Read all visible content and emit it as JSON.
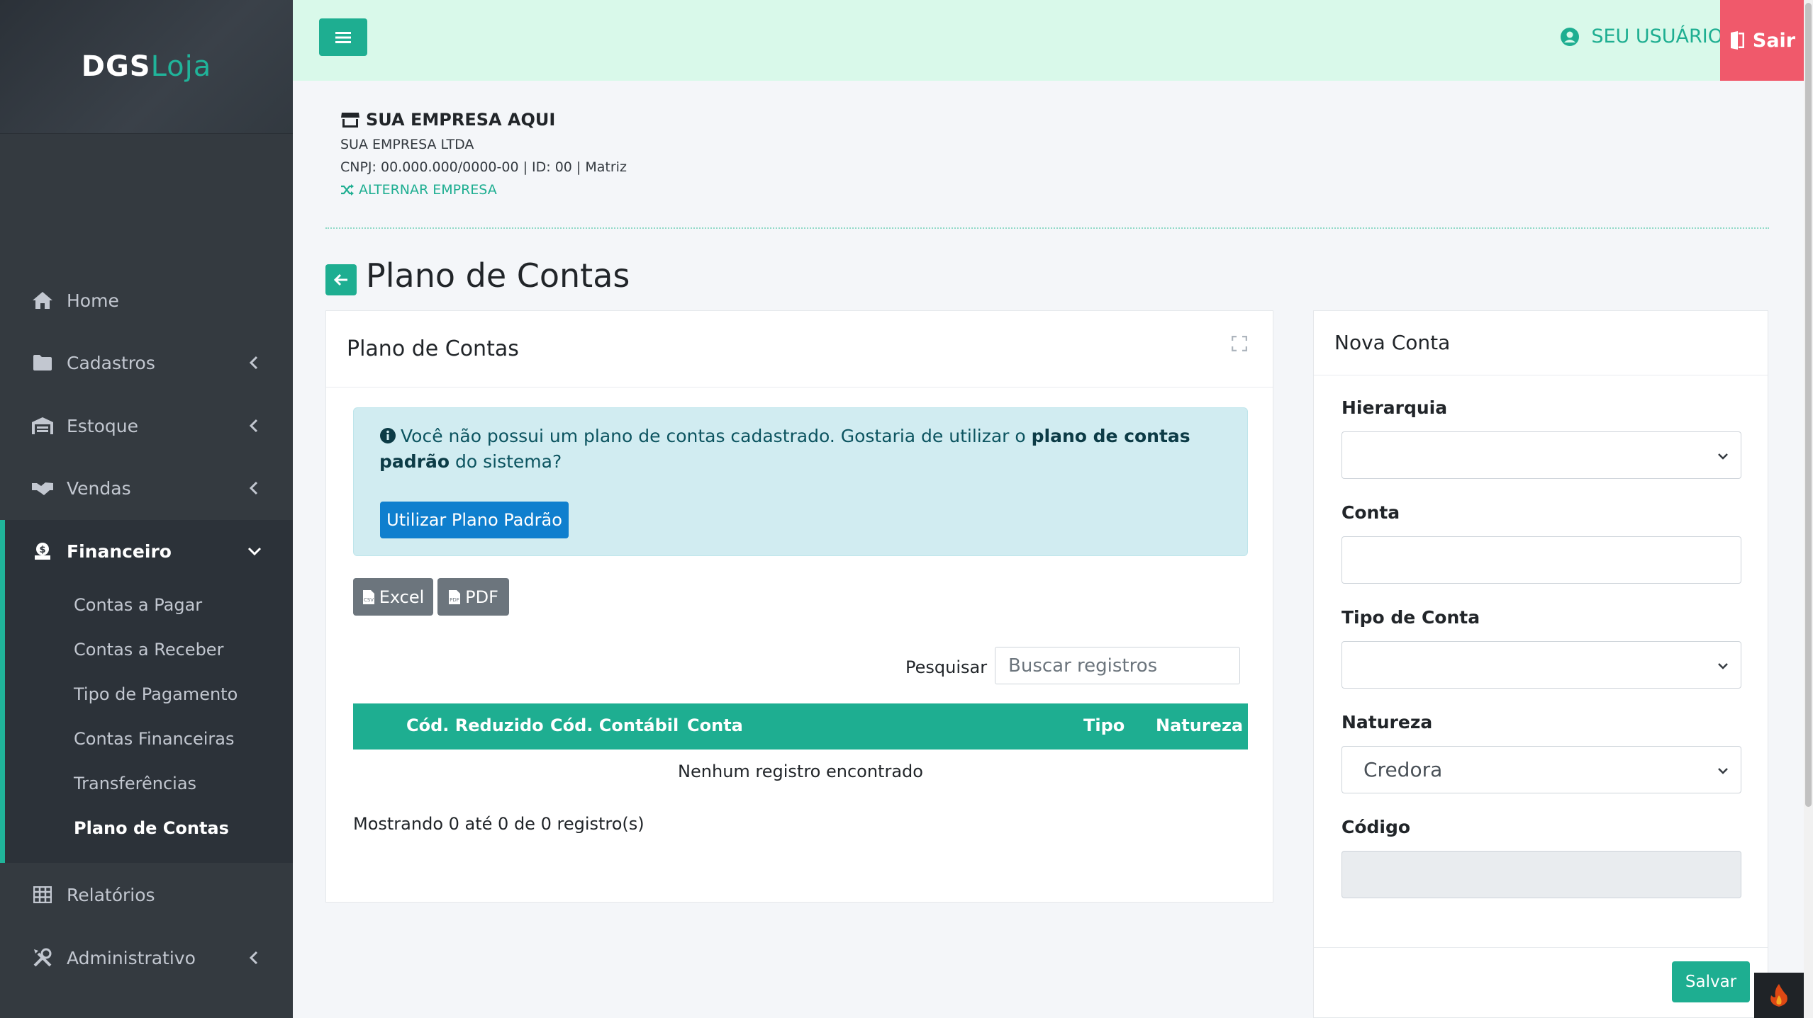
{
  "brand": {
    "main": "DGS",
    "accent": "Loja"
  },
  "sidebar": {
    "items": [
      {
        "label": "Home",
        "icon": "home-icon"
      },
      {
        "label": "Cadastros",
        "icon": "folder-icon"
      },
      {
        "label": "Estoque",
        "icon": "warehouse-icon"
      },
      {
        "label": "Vendas",
        "icon": "handshake-icon"
      },
      {
        "label": "Financeiro",
        "icon": "money-icon"
      },
      {
        "label": "Relatórios",
        "icon": "table-icon"
      },
      {
        "label": "Administrativo",
        "icon": "tools-icon"
      }
    ],
    "financeiro_sub": [
      "Contas a Pagar",
      "Contas a Receber",
      "Tipo de Pagamento",
      "Contas Financeiras",
      "Transferências",
      "Plano de Contas"
    ]
  },
  "topbar": {
    "user": "SEU USUÁRIO",
    "logout": "Sair"
  },
  "company": {
    "name": "SUA EMPRESA AQUI",
    "legal_name": "SUA EMPRESA LTDA",
    "details": "CNPJ: 00.000.000/0000-00 | ID: 00 | Matriz",
    "switch_label": "ALTERNAR EMPRESA"
  },
  "page": {
    "title": "Plano de Contas"
  },
  "main_card": {
    "title": "Plano de Contas",
    "alert": {
      "text_before": "Você não possui um plano de contas cadastrado. Gostaria de utilizar o ",
      "text_bold": "plano de contas padrão",
      "text_after": " do sistema?",
      "button": "Utilizar Plano Padrão"
    },
    "export": {
      "excel": "Excel",
      "pdf": "PDF"
    },
    "search": {
      "label": "Pesquisar",
      "placeholder": "Buscar registros"
    },
    "table": {
      "columns": [
        "Cód. Reduzido",
        "Cód. Contábil",
        "Conta",
        "Tipo",
        "Natureza"
      ],
      "empty": "Nenhum registro encontrado"
    },
    "showing": "Mostrando 0 até 0 de 0 registro(s)"
  },
  "form_card": {
    "title": "Nova Conta",
    "fields": {
      "hierarquia": {
        "label": "Hierarquia",
        "value": ""
      },
      "conta": {
        "label": "Conta",
        "value": ""
      },
      "tipo": {
        "label": "Tipo de Conta",
        "value": ""
      },
      "natureza": {
        "label": "Natureza",
        "value": "Credora"
      },
      "codigo": {
        "label": "Código",
        "value": ""
      }
    },
    "save": "Salvar"
  },
  "colors": {
    "sidebar_bg": "#343a40",
    "accent": "#1eae91",
    "topbar_bg": "#d9f9ea",
    "logout_bg": "#f0596b",
    "primary_btn": "#0f7fce",
    "alert_bg": "#d1ecf1"
  }
}
